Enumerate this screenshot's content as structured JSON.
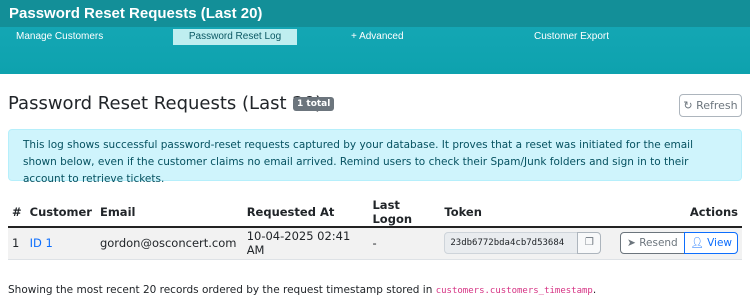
{
  "window": {
    "title": "Password Reset Requests (Last 20)"
  },
  "tabs": [
    {
      "label": "Manage Customers"
    },
    {
      "label": "Password Reset Log"
    },
    {
      "label": "+  Advanced"
    },
    {
      "label": "Customer Export"
    }
  ],
  "page": {
    "heading": "Password Reset Requests (Last 20)",
    "badge": "1 total",
    "refresh_label": "Refresh",
    "alert_text": "This log shows successful password-reset requests captured by your database. It proves that a reset was initiated for the email shown below, even if the customer claims no email arrived. Remind users to check their Spam/Junk folders and sign in to their account to retrieve tickets."
  },
  "table": {
    "headers": [
      "#",
      "Customer",
      "Email",
      "Requested At",
      "Last Logon",
      "Token",
      "Actions"
    ],
    "rows": [
      {
        "num": "1",
        "customer": "ID 1",
        "email": "gordon@osconcert.com",
        "requested_at": "10-04-2025 02:41 AM",
        "last_logon": "-",
        "token": "23db6772bda4cb7d53684",
        "resend_label": "Resend",
        "view_label": "View"
      }
    ]
  },
  "footer": {
    "text": "Showing the most recent 20 records ordered by the request timestamp stored in",
    "code": "customers.customers_timestamp",
    "period": "."
  },
  "colors": {
    "accent": "#138f98",
    "link": "#0d6efd",
    "info_bg": "#cff4fc",
    "code": "#d63384"
  }
}
